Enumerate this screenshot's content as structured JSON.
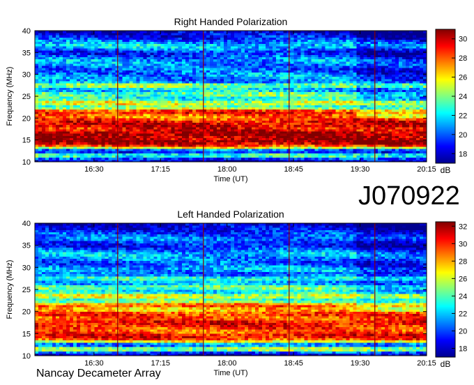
{
  "observation_id": "J070922",
  "footer_text": "Nancay Decameter Array",
  "colormap": [
    "#00008f",
    "#0000ff",
    "#0080ff",
    "#00ffff",
    "#80ff80",
    "#ffff00",
    "#ff8000",
    "#ff0000",
    "#800000"
  ],
  "chart_data": [
    {
      "type": "heatmap",
      "title": "Right Handed Polarization",
      "xlabel": "Time (UT)",
      "ylabel": "Frequency (MHz)",
      "x_tick_labels": [
        "16:30",
        "17:15",
        "18:00",
        "18:45",
        "19:30",
        "20:15"
      ],
      "x_ticks_minutes": [
        990,
        1035,
        1080,
        1125,
        1170,
        1215
      ],
      "xlim_minutes": [
        950,
        1215
      ],
      "ylim": [
        10,
        40
      ],
      "y_tick_labels": [
        "10",
        "15",
        "20",
        "25",
        "30",
        "35",
        "40"
      ],
      "y_ticks": [
        10,
        15,
        20,
        25,
        30,
        35,
        40
      ],
      "colorbar_label": "dB",
      "colorbar_range": [
        17,
        31
      ],
      "colorbar_ticks": [
        "18",
        "20",
        "22",
        "24",
        "26",
        "28",
        "30"
      ],
      "colorbar_tick_values": [
        18,
        20,
        22,
        24,
        26,
        28,
        30
      ],
      "vertical_markers_minutes": [
        1006,
        1064,
        1122,
        1180
      ],
      "intensity_profile_db": [
        {
          "freq": 10.5,
          "db": 18
        },
        {
          "freq": 11.5,
          "db": 24
        },
        {
          "freq": 12.5,
          "db": 18
        },
        {
          "freq": 13.5,
          "db": 28
        },
        {
          "freq": 14.5,
          "db": 31
        },
        {
          "freq": 15.5,
          "db": 30
        },
        {
          "freq": 16.5,
          "db": 31
        },
        {
          "freq": 17.5,
          "db": 29
        },
        {
          "freq": 18.5,
          "db": 30
        },
        {
          "freq": 19.5,
          "db": 29
        },
        {
          "freq": 20.5,
          "db": 27
        },
        {
          "freq": 21.5,
          "db": 30
        },
        {
          "freq": 22.5,
          "db": 23
        },
        {
          "freq": 23.5,
          "db": 26
        },
        {
          "freq": 24.5,
          "db": 22
        },
        {
          "freq": 25.5,
          "db": 24
        },
        {
          "freq": 26.5,
          "db": 21
        },
        {
          "freq": 27.5,
          "db": 25
        },
        {
          "freq": 28.5,
          "db": 20
        },
        {
          "freq": 29.5,
          "db": 21
        },
        {
          "freq": 31,
          "db": 20
        },
        {
          "freq": 33,
          "db": 21
        },
        {
          "freq": 35,
          "db": 19
        },
        {
          "freq": 36.5,
          "db": 22
        },
        {
          "freq": 38.5,
          "db": 19
        },
        {
          "freq": 39.7,
          "db": 18
        }
      ]
    },
    {
      "type": "heatmap",
      "title": "Left Handed Polarization",
      "xlabel": "Time (UT)",
      "ylabel": "Frequency (MHz)",
      "x_tick_labels": [
        "16:30",
        "17:15",
        "18:00",
        "18:45",
        "19:30",
        "20:15"
      ],
      "x_ticks_minutes": [
        990,
        1035,
        1080,
        1125,
        1170,
        1215
      ],
      "xlim_minutes": [
        950,
        1215
      ],
      "ylim": [
        10,
        40
      ],
      "y_tick_labels": [
        "10",
        "15",
        "20",
        "25",
        "30",
        "35",
        "40"
      ],
      "y_ticks": [
        10,
        15,
        20,
        25,
        30,
        35,
        40
      ],
      "colorbar_label": "dB",
      "colorbar_range": [
        17,
        32.5
      ],
      "colorbar_ticks": [
        "18",
        "20",
        "22",
        "24",
        "26",
        "28",
        "30",
        "32"
      ],
      "colorbar_tick_values": [
        18,
        20,
        22,
        24,
        26,
        28,
        30,
        32
      ],
      "vertical_markers_minutes": [
        1006,
        1064,
        1122,
        1180
      ],
      "intensity_profile_db": [
        {
          "freq": 10.5,
          "db": 18
        },
        {
          "freq": 11.5,
          "db": 27
        },
        {
          "freq": 12.5,
          "db": 19
        },
        {
          "freq": 13.5,
          "db": 29
        },
        {
          "freq": 14.5,
          "db": 31
        },
        {
          "freq": 15.5,
          "db": 29
        },
        {
          "freq": 16.5,
          "db": 30
        },
        {
          "freq": 17.5,
          "db": 31
        },
        {
          "freq": 18.5,
          "db": 29
        },
        {
          "freq": 19.5,
          "db": 30
        },
        {
          "freq": 20.5,
          "db": 27
        },
        {
          "freq": 21.5,
          "db": 30
        },
        {
          "freq": 22.5,
          "db": 23
        },
        {
          "freq": 23.5,
          "db": 27
        },
        {
          "freq": 24.5,
          "db": 22
        },
        {
          "freq": 25.5,
          "db": 25
        },
        {
          "freq": 26.5,
          "db": 21
        },
        {
          "freq": 27.5,
          "db": 24
        },
        {
          "freq": 28.5,
          "db": 20
        },
        {
          "freq": 29.5,
          "db": 22
        },
        {
          "freq": 31,
          "db": 20
        },
        {
          "freq": 33,
          "db": 22
        },
        {
          "freq": 35,
          "db": 19
        },
        {
          "freq": 36.5,
          "db": 21
        },
        {
          "freq": 38.5,
          "db": 19
        },
        {
          "freq": 39.7,
          "db": 18
        }
      ]
    }
  ]
}
